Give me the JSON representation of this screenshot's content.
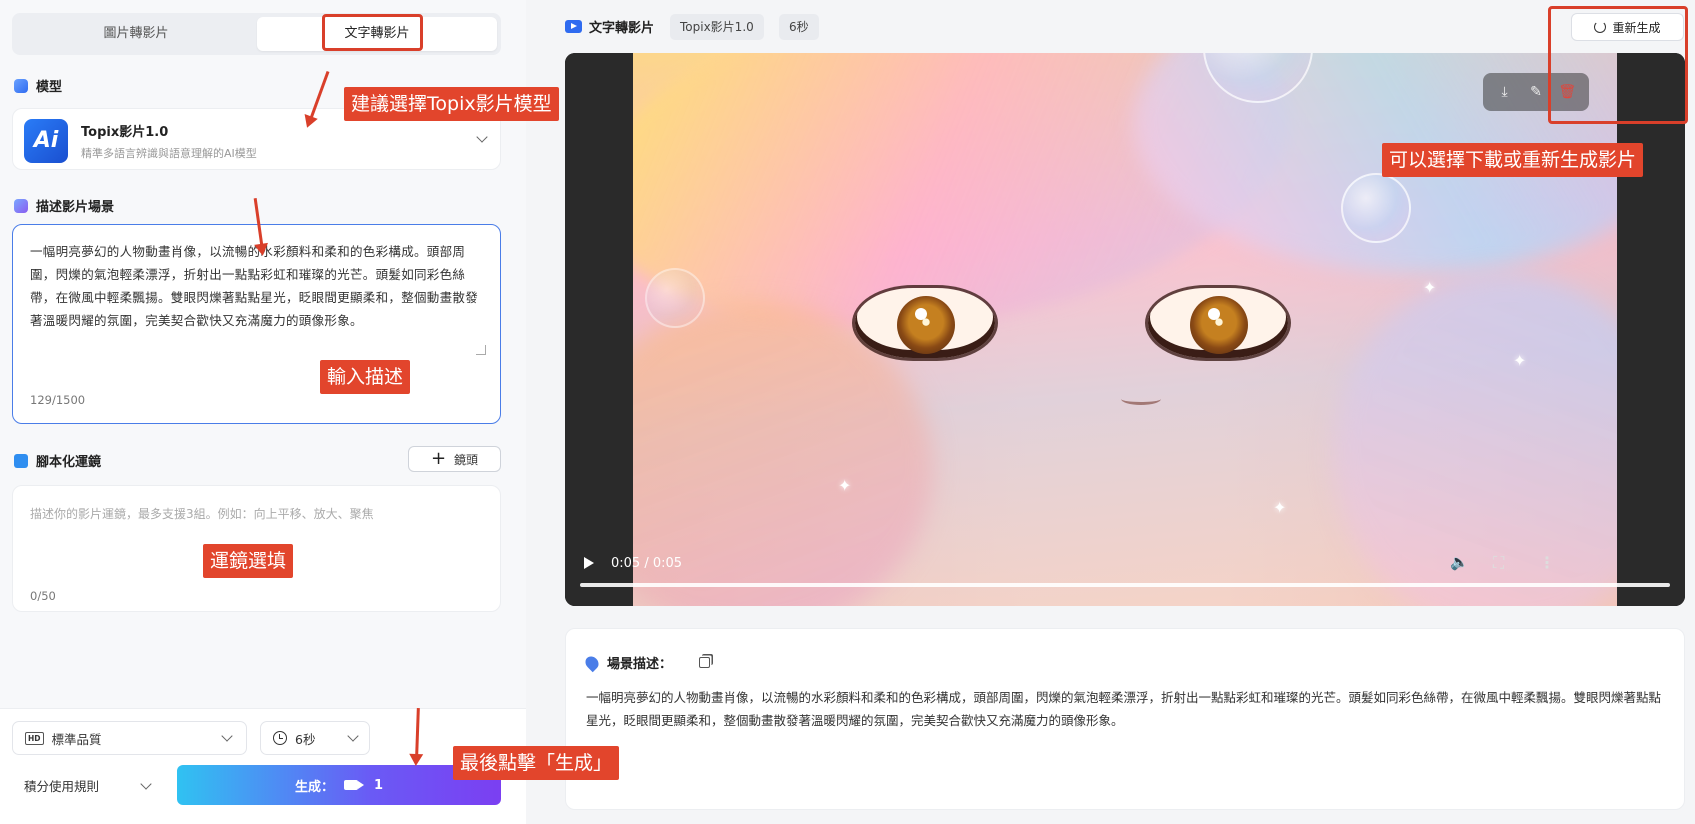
{
  "left": {
    "tabs": [
      "圖片轉影片",
      "文字轉影片"
    ],
    "model_section": "模型",
    "model": {
      "logo": "Ai",
      "name": "Topix影片1.0",
      "desc": "精準多語言辨識與語意理解的AI模型"
    },
    "scene_section": "描述影片場景",
    "scene_text": "一幅明亮夢幻的人物動畫肖像，以流暢的水彩顏料和柔和的色彩構成。頭部周圍，閃爍的氣泡輕柔漂浮，折射出一點點彩虹和璀璨的光芒。頭髮如同彩色絲帶，在微風中輕柔飄揚。雙眼閃爍著點點星光，眨眼間更顯柔和，整個動畫散發著溫暖閃耀的氛圍，完美契合歡快又充滿魔力的頭像形象。",
    "scene_count": "129/1500",
    "shot_section": "腳本化運鏡",
    "lens_button": "鏡頭",
    "shot_placeholder": "描述你的影片運鏡，最多支援3組。例如：向上平移、放大、聚焦",
    "shot_count": "0/50",
    "quality": {
      "icon": "HD",
      "value": "標準品質"
    },
    "duration": "6秒",
    "rules": "積分使用規則",
    "generate": {
      "label": "生成：",
      "cost": "1"
    }
  },
  "right": {
    "title": "文字轉影片",
    "chips": [
      "Topix影片1.0",
      "6秒"
    ],
    "regen_button": "重新生成",
    "tools": [
      "download-icon",
      "edit-icon",
      "delete-icon"
    ],
    "time": "0:05 / 0:05",
    "progress": 1.0,
    "desc_title": "場景描述：",
    "desc_text": "一幅明亮夢幻的人物動畫肖像，以流暢的水彩顏料和柔和的色彩構成，頭部周圍，閃爍的氣泡輕柔漂浮，折射出一點點彩虹和璀璨的光芒。頭髮如同彩色絲帶，在微風中輕柔飄揚。雙眼閃爍著點點星光，眨眼間更顯柔和，整個動畫散發著溫暖閃耀的氛圍，完美契合歡快又充滿魔力的頭像形象。"
  },
  "annotations": {
    "model": "建議選擇Topix影片模型",
    "desc": "輸入描述",
    "shot": "運鏡選填",
    "generate": "最後點擊「生成」",
    "download": "可以選擇下載或重新生成影片"
  },
  "colors": {
    "accent": "#4a7de8",
    "annotation": "#e2452c",
    "delete": "#e0463c"
  }
}
